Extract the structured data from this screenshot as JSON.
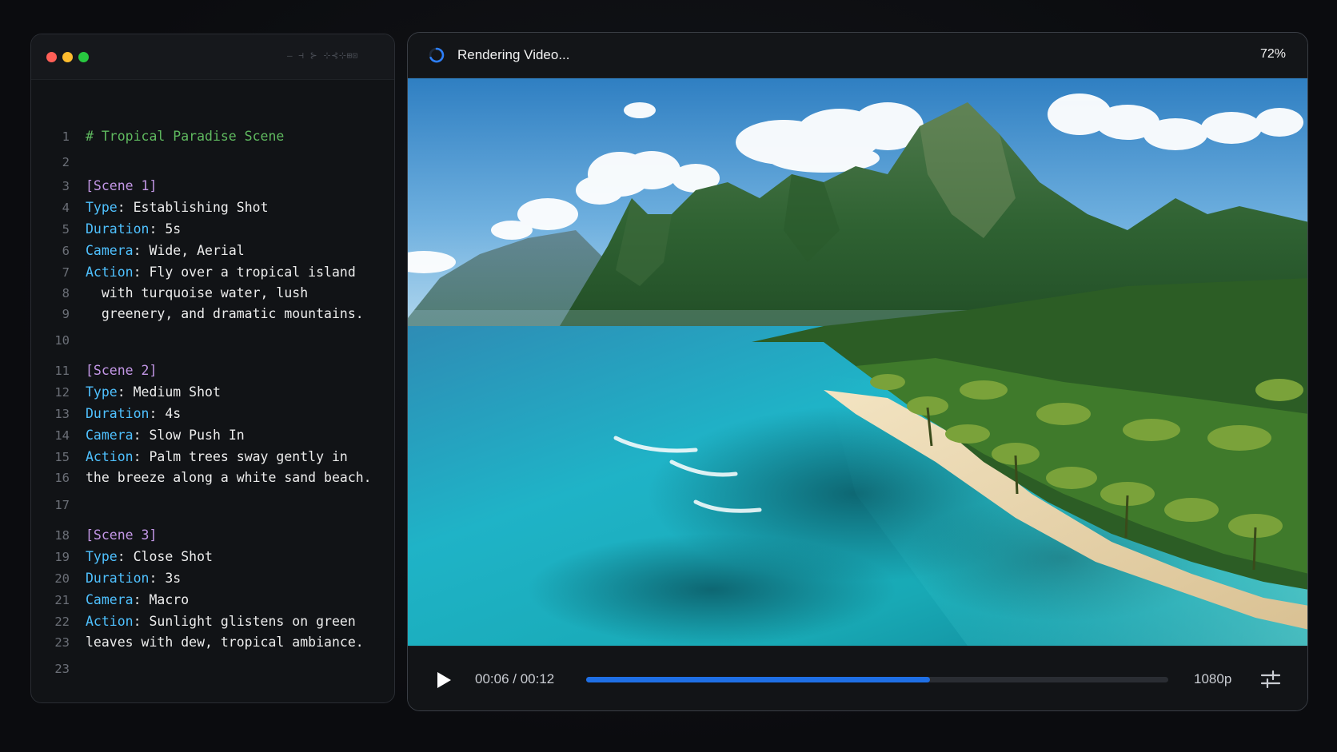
{
  "editor": {
    "title_caption": "— ⊣ ⊱ ⊹⊰⊹⊞⊡",
    "lines": [
      {
        "n": "1",
        "parts": [
          {
            "t": "comment",
            "v": "# Tropical Paradise Scene"
          }
        ]
      },
      {
        "n": "2",
        "parts": []
      },
      {
        "n": "3",
        "parts": [
          {
            "t": "section",
            "v": "[Scene 1]"
          }
        ]
      },
      {
        "n": "4",
        "parts": [
          {
            "t": "key",
            "v": "Type"
          },
          {
            "t": "punct",
            "v": ": "
          },
          {
            "t": "val",
            "v": "Establishing Shot"
          }
        ]
      },
      {
        "n": "5",
        "parts": [
          {
            "t": "key",
            "v": "Duration"
          },
          {
            "t": "punct",
            "v": ": "
          },
          {
            "t": "val",
            "v": "5s"
          }
        ]
      },
      {
        "n": "6",
        "parts": [
          {
            "t": "key",
            "v": "Camera"
          },
          {
            "t": "punct",
            "v": ": "
          },
          {
            "t": "val",
            "v": "Wide, Aerial"
          }
        ]
      },
      {
        "n": "7",
        "parts": [
          {
            "t": "key",
            "v": "Action"
          },
          {
            "t": "punct",
            "v": ": "
          },
          {
            "t": "val",
            "v": "Fly over a tropical island"
          }
        ]
      },
      {
        "n": "8",
        "parts": [
          {
            "t": "val",
            "v": "  with turquoise water, lush"
          }
        ]
      },
      {
        "n": "9",
        "parts": [
          {
            "t": "val",
            "v": "  greenery, and dramatic mountains."
          }
        ]
      },
      {
        "n": "10",
        "parts": []
      },
      {
        "n": "11",
        "parts": [
          {
            "t": "section",
            "v": "[Scene 2]"
          }
        ]
      },
      {
        "n": "12",
        "parts": [
          {
            "t": "key",
            "v": "Type"
          },
          {
            "t": "punct",
            "v": ": "
          },
          {
            "t": "val",
            "v": "Medium Shot"
          }
        ]
      },
      {
        "n": "13",
        "parts": [
          {
            "t": "key",
            "v": "Duration"
          },
          {
            "t": "punct",
            "v": ": "
          },
          {
            "t": "val",
            "v": "4s"
          }
        ]
      },
      {
        "n": "14",
        "parts": [
          {
            "t": "key",
            "v": "Camera"
          },
          {
            "t": "punct",
            "v": ": "
          },
          {
            "t": "val",
            "v": "Slow Push In"
          }
        ]
      },
      {
        "n": "15",
        "parts": [
          {
            "t": "key",
            "v": "Action"
          },
          {
            "t": "punct",
            "v": ": "
          },
          {
            "t": "val",
            "v": "Palm trees sway gently in"
          }
        ]
      },
      {
        "n": "16",
        "parts": [
          {
            "t": "val",
            "v": "the breeze along a white sand beach."
          }
        ]
      },
      {
        "n": "17",
        "parts": []
      },
      {
        "n": "18",
        "parts": [
          {
            "t": "section",
            "v": "[Scene 3]"
          }
        ]
      },
      {
        "n": "19",
        "parts": [
          {
            "t": "key",
            "v": "Type"
          },
          {
            "t": "punct",
            "v": ": "
          },
          {
            "t": "val",
            "v": "Close Shot"
          }
        ]
      },
      {
        "n": "20",
        "parts": [
          {
            "t": "key",
            "v": "Duration"
          },
          {
            "t": "punct",
            "v": ": "
          },
          {
            "t": "val",
            "v": "3s"
          }
        ]
      },
      {
        "n": "21",
        "parts": [
          {
            "t": "key",
            "v": "Camera"
          },
          {
            "t": "punct",
            "v": ": "
          },
          {
            "t": "val",
            "v": "Macro"
          }
        ]
      },
      {
        "n": "22",
        "parts": [
          {
            "t": "key",
            "v": "Action"
          },
          {
            "t": "punct",
            "v": ": "
          },
          {
            "t": "val",
            "v": "Sunlight glistens on green"
          }
        ]
      },
      {
        "n": "23",
        "parts": [
          {
            "t": "val",
            "v": "leaves with dew, tropical ambiance."
          }
        ]
      },
      {
        "n": "23",
        "parts": []
      }
    ]
  },
  "player": {
    "status_label": "Rendering Video...",
    "render_percent_label": "72%",
    "time_label": "00:06 / 00:12",
    "playback_progress": 0.59,
    "quality_label": "1080p",
    "icons": {
      "spinner": "loading-spinner-icon",
      "play": "play-icon",
      "settings": "sliders-icon"
    }
  },
  "colors": {
    "accent": "#1f6fe5",
    "comment": "#5fb95f",
    "section": "#c397e6",
    "key": "#4fc1ff"
  }
}
